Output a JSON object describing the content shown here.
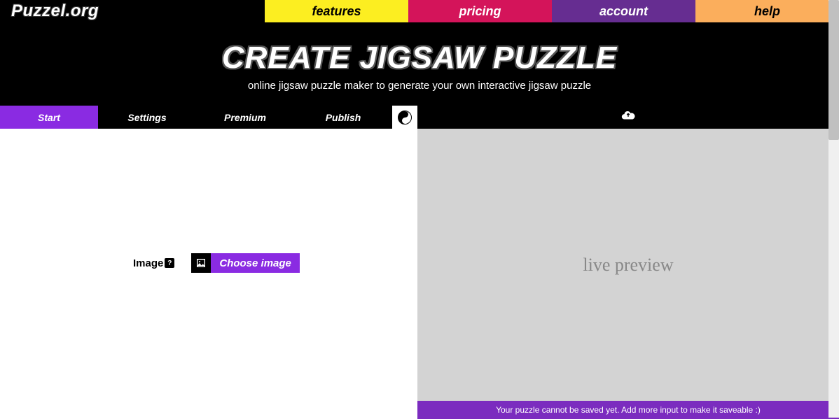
{
  "logo": "Puzzel.org",
  "nav": {
    "features": "features",
    "pricing": "pricing",
    "account": "account",
    "help": "help"
  },
  "hero": {
    "title": "CREATE JIGSAW PUZZLE",
    "subtitle": "online jigsaw puzzle maker to generate your own interactive jigsaw puzzle"
  },
  "tabs": {
    "start": "Start",
    "settings": "Settings",
    "premium": "Premium",
    "publish": "Publish"
  },
  "form": {
    "image_label": "Image",
    "help_badge": "?",
    "choose_image": "Choose image"
  },
  "preview": {
    "placeholder": "live preview"
  },
  "savebar": {
    "message": "Your puzzle cannot be saved yet. Add more input to make it saveable :)"
  }
}
